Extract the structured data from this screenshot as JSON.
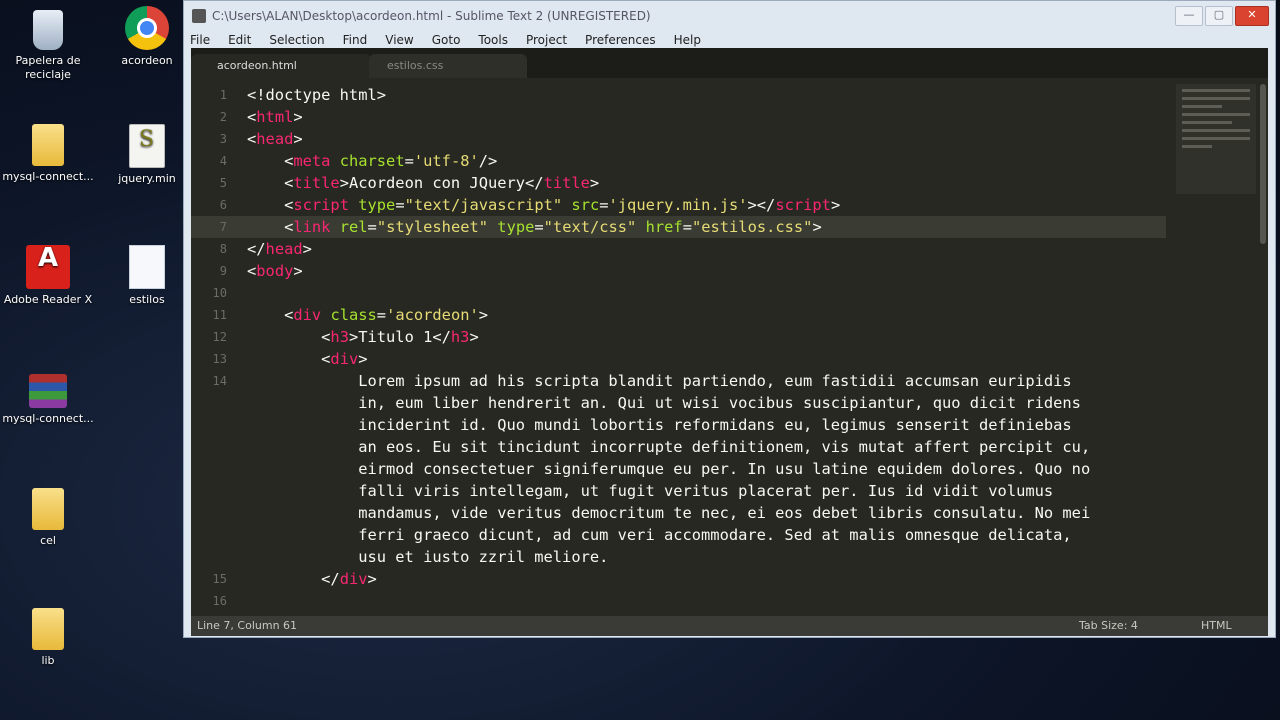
{
  "desktop": {
    "icons": [
      {
        "label": "Papelera de reciclaje",
        "icon": "recycle-bin-icon"
      },
      {
        "label": "acordeon",
        "icon": "chrome-icon"
      },
      {
        "label": "mysql-connect...",
        "icon": "folder-icon"
      },
      {
        "label": "jquery.min",
        "icon": "script-file-icon"
      },
      {
        "label": "Adobe Reader X",
        "icon": "pdf-icon"
      },
      {
        "label": "estilos",
        "icon": "document-icon"
      },
      {
        "label": "mysql-connect...",
        "icon": "archive-icon"
      },
      {
        "label": "cel",
        "icon": "folder-icon"
      },
      {
        "label": "lib",
        "icon": "folder-icon"
      }
    ]
  },
  "window": {
    "title": "C:\\Users\\ALAN\\Desktop\\acordeon.html - Sublime Text 2 (UNREGISTERED)",
    "controls": {
      "minimize": "—",
      "maximize": "▢",
      "close": "✕"
    }
  },
  "menu": [
    "File",
    "Edit",
    "Selection",
    "Find",
    "View",
    "Goto",
    "Tools",
    "Project",
    "Preferences",
    "Help"
  ],
  "tabs": [
    {
      "label": "acordeon.html",
      "active": true
    },
    {
      "label": "estilos.css",
      "active": false
    }
  ],
  "code": {
    "lines": [
      {
        "n": "1",
        "indent": "",
        "parts": [
          [
            "t",
            "<!doctype html>"
          ]
        ]
      },
      {
        "n": "2",
        "indent": "",
        "parts": [
          [
            "t",
            "<"
          ],
          [
            "tag",
            "html"
          ],
          [
            "t",
            ">"
          ]
        ]
      },
      {
        "n": "3",
        "indent": "",
        "parts": [
          [
            "t",
            "<"
          ],
          [
            "tag",
            "head"
          ],
          [
            "t",
            ">"
          ]
        ]
      },
      {
        "n": "4",
        "indent": "    ",
        "parts": [
          [
            "t",
            "<"
          ],
          [
            "tag",
            "meta"
          ],
          [
            "t",
            " "
          ],
          [
            "attr",
            "charset"
          ],
          [
            "t",
            "="
          ],
          [
            "str",
            "'utf-8'"
          ],
          [
            "t",
            "/>"
          ]
        ]
      },
      {
        "n": "5",
        "indent": "    ",
        "parts": [
          [
            "t",
            "<"
          ],
          [
            "tag",
            "title"
          ],
          [
            "t",
            ">Acordeon con JQuery</"
          ],
          [
            "tag",
            "title"
          ],
          [
            "t",
            ">"
          ]
        ]
      },
      {
        "n": "6",
        "indent": "    ",
        "parts": [
          [
            "t",
            "<"
          ],
          [
            "tag",
            "script"
          ],
          [
            "t",
            " "
          ],
          [
            "attr",
            "type"
          ],
          [
            "t",
            "="
          ],
          [
            "str",
            "\"text/javascript\""
          ],
          [
            "t",
            " "
          ],
          [
            "attr",
            "src"
          ],
          [
            "t",
            "="
          ],
          [
            "str",
            "'jquery.min.js'"
          ],
          [
            "t",
            "></"
          ],
          [
            "tag",
            "script"
          ],
          [
            "t",
            ">"
          ]
        ]
      },
      {
        "n": "7",
        "indent": "    ",
        "parts": [
          [
            "t",
            "<"
          ],
          [
            "tag",
            "link"
          ],
          [
            "t",
            " "
          ],
          [
            "attr",
            "rel"
          ],
          [
            "t",
            "="
          ],
          [
            "str",
            "\"stylesheet\""
          ],
          [
            "t",
            " "
          ],
          [
            "attr",
            "type"
          ],
          [
            "t",
            "="
          ],
          [
            "str",
            "\"text/css\""
          ],
          [
            "t",
            " "
          ],
          [
            "attr",
            "href"
          ],
          [
            "t",
            "="
          ],
          [
            "str",
            "\"estilos.css\""
          ],
          [
            "t",
            ">"
          ]
        ]
      },
      {
        "n": "8",
        "indent": "",
        "parts": [
          [
            "t",
            "</"
          ],
          [
            "tag",
            "head"
          ],
          [
            "t",
            ">"
          ]
        ]
      },
      {
        "n": "9",
        "indent": "",
        "parts": [
          [
            "t",
            "<"
          ],
          [
            "tag",
            "body"
          ],
          [
            "t",
            ">"
          ]
        ]
      },
      {
        "n": "10",
        "indent": "",
        "parts": []
      },
      {
        "n": "11",
        "indent": "    ",
        "parts": [
          [
            "t",
            "<"
          ],
          [
            "tag",
            "div"
          ],
          [
            "t",
            " "
          ],
          [
            "attr",
            "class"
          ],
          [
            "t",
            "="
          ],
          [
            "str",
            "'acordeon'"
          ],
          [
            "t",
            ">"
          ]
        ]
      },
      {
        "n": "12",
        "indent": "        ",
        "parts": [
          [
            "t",
            "<"
          ],
          [
            "tag",
            "h3"
          ],
          [
            "t",
            ">Titulo 1</"
          ],
          [
            "tag",
            "h3"
          ],
          [
            "t",
            ">"
          ]
        ]
      },
      {
        "n": "13",
        "indent": "        ",
        "parts": [
          [
            "t",
            "<"
          ],
          [
            "tag",
            "div"
          ],
          [
            "t",
            ">"
          ]
        ]
      },
      {
        "n": "14",
        "indent": "            ",
        "parts": [
          [
            "t",
            "Lorem ipsum ad his scripta blandit partiendo, eum fastidii accumsan euripidis"
          ]
        ]
      },
      {
        "n": "",
        "indent": "            ",
        "parts": [
          [
            "t",
            "in, eum liber hendrerit an. Qui ut wisi vocibus suscipiantur, quo dicit ridens"
          ]
        ]
      },
      {
        "n": "",
        "indent": "            ",
        "parts": [
          [
            "t",
            "inciderint id. Quo mundi lobortis reformidans eu, legimus senserit definiebas"
          ]
        ]
      },
      {
        "n": "",
        "indent": "            ",
        "parts": [
          [
            "t",
            "an eos. Eu sit tincidunt incorrupte definitionem, vis mutat affert percipit cu,"
          ]
        ]
      },
      {
        "n": "",
        "indent": "            ",
        "parts": [
          [
            "t",
            "eirmod consectetuer signiferumque eu per. In usu latine equidem dolores. Quo no"
          ]
        ]
      },
      {
        "n": "",
        "indent": "            ",
        "parts": [
          [
            "t",
            "falli viris intellegam, ut fugit veritus placerat per. Ius id vidit volumus"
          ]
        ]
      },
      {
        "n": "",
        "indent": "            ",
        "parts": [
          [
            "t",
            "mandamus, vide veritus democritum te nec, ei eos debet libris consulatu. No mei"
          ]
        ]
      },
      {
        "n": "",
        "indent": "            ",
        "parts": [
          [
            "t",
            "ferri graeco dicunt, ad cum veri accommodare. Sed at malis omnesque delicata,"
          ]
        ]
      },
      {
        "n": "",
        "indent": "            ",
        "parts": [
          [
            "t",
            "usu et iusto zzril meliore."
          ]
        ]
      },
      {
        "n": "15",
        "indent": "        ",
        "parts": [
          [
            "t",
            "</"
          ],
          [
            "tag",
            "div"
          ],
          [
            "t",
            ">"
          ]
        ]
      },
      {
        "n": "16",
        "indent": "",
        "parts": []
      }
    ],
    "current_line": "7"
  },
  "status": {
    "position": "Line 7, Column 61",
    "tab_size": "Tab Size: 4",
    "syntax": "HTML"
  },
  "colors": {
    "editor_bg": "#272822",
    "tag": "#f92672",
    "attribute": "#a6e22e",
    "string": "#e6db74",
    "text": "#f8f8f2"
  }
}
